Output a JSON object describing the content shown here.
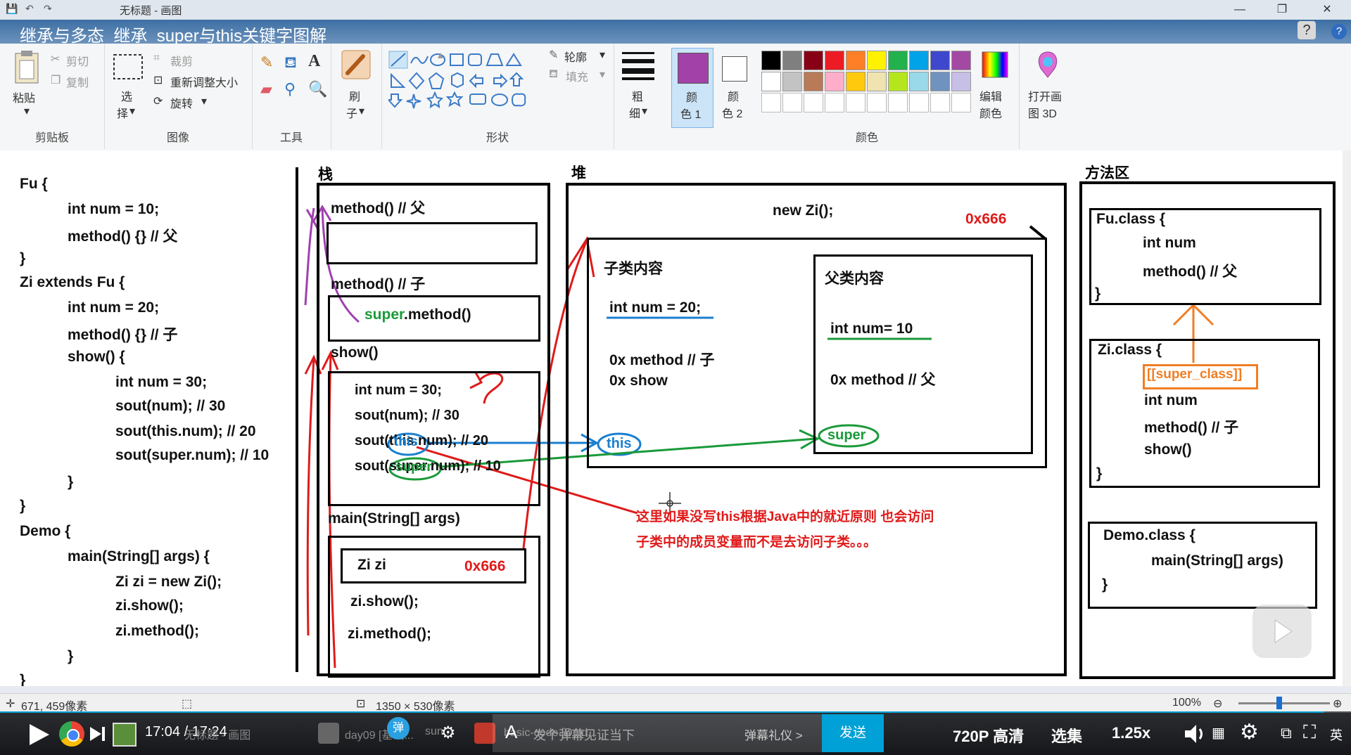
{
  "window": {
    "title": "无标题 - 画图"
  },
  "video": {
    "title": "继承与多态_继承_super与this关键字图解",
    "help": "?"
  },
  "ribbon": {
    "clipboard": {
      "paste": "粘贴",
      "cut": "剪切",
      "copy": "复制",
      "group": "剪贴板"
    },
    "image": {
      "select": "选",
      "select2": "择",
      "crop": "裁剪",
      "resize": "重新调整大小",
      "rotate": "旋转",
      "group": "图像"
    },
    "tools": {
      "group": "工具",
      "text_tool": "A"
    },
    "brush": {
      "label": "刷",
      "label2": "子"
    },
    "shapes": {
      "group": "形状",
      "outline": "轮廓",
      "fill": "填充"
    },
    "size": {
      "label": "粗",
      "label2": "细"
    },
    "color1": {
      "label": "颜",
      "label2": "色 1",
      "color": "#a242a8"
    },
    "color2": {
      "label": "颜",
      "label2": "色 2"
    },
    "colors": {
      "group": "颜色",
      "palette_row1": [
        "#000000",
        "#7f7f7f",
        "#880015",
        "#ed1c24",
        "#ff7f27",
        "#fff200",
        "#22b14c",
        "#00a2e8",
        "#3f48cc",
        "#a349a4"
      ],
      "palette_row2": [
        "#ffffff",
        "#c3c3c3",
        "#b97a57",
        "#ffaec9",
        "#ffc90e",
        "#efe4b0",
        "#b5e61d",
        "#99d9ea",
        "#7092be",
        "#c8bfe7"
      ],
      "edit": "编辑",
      "edit2": "颜色"
    },
    "paint3d": {
      "label": "打开画",
      "label2": "图 3D"
    }
  },
  "code": {
    "lines": [
      "Fu {",
      "int num = 10;",
      "method() {} // 父",
      "}",
      "Zi extends Fu {",
      "int num = 20;",
      "method() {} // 子",
      "show() {",
      "int num = 30;",
      "sout(num); // 30",
      "sout(this.num); // 20",
      "sout(super.num); // 10",
      "}",
      "}",
      "Demo {",
      "main(String[] args) {",
      "Zi zi = new Zi();",
      "zi.show();",
      "zi.method();",
      "}",
      "}"
    ]
  },
  "stack": {
    "title": "栈",
    "method_fu": "method() // 父",
    "method_zi": "method() // 子",
    "super_kw": "super",
    "super_rest": ".method()",
    "show": "show()",
    "show_lines": [
      "int num = 30;",
      "sout(num); // 30",
      "sout(this.num); // 20",
      "sout(super.num); // 10"
    ],
    "this_tag": "this",
    "super_tag": "super",
    "main": "main(String[] args)",
    "zi_var": "Zi zi",
    "zi_addr": "0x666",
    "zi_show": "zi.show();",
    "zi_method": "zi.method();"
  },
  "heap": {
    "title": "堆",
    "new_zi": "new Zi();",
    "addr": "0x666",
    "child_title": "子类内容",
    "child_num": "int num = 20;",
    "child_method": "0x method // 子",
    "child_show": "0x show",
    "parent_title": "父类内容",
    "parent_num": "int num= 10",
    "parent_method": "0x method // 父",
    "this_label": "this",
    "super_label": "super"
  },
  "method_area": {
    "title": "方法区",
    "fu_class": "Fu.class {",
    "fu_num": "int num",
    "fu_method": "method() // 父",
    "close": "}",
    "zi_class": "Zi.class {",
    "super_class": "[[super_class]]",
    "zi_num": "int num",
    "zi_method": "method() // 子",
    "zi_show": "show()",
    "demo_class": "Demo.class {",
    "demo_main": "main(String[] args)"
  },
  "note": {
    "line1": "这里如果没写this根据Java中的就近原则 也会访问",
    "line2": "子类中的成员变量而不是去访问子类。。。"
  },
  "status": {
    "coords": "671, 459像素",
    "canvas_size": "1350 × 530像素",
    "zoom": "100%"
  },
  "player": {
    "time": "17:04 / 17:24",
    "danmaku_placeholder": "发个弹幕见证当下",
    "danmaku_etiquette": "弹幕礼仪 >",
    "send": "发送",
    "quality": "720P 高清",
    "episodes": "选集",
    "speed": "1.25x",
    "danmaku_toggle": "弹",
    "lang": "英",
    "progress": 0.98,
    "taskbar": [
      "无标题 - 画图",
      "day09 [基础...",
      "sun...",
      "basic-code [D:\\id..."
    ]
  }
}
